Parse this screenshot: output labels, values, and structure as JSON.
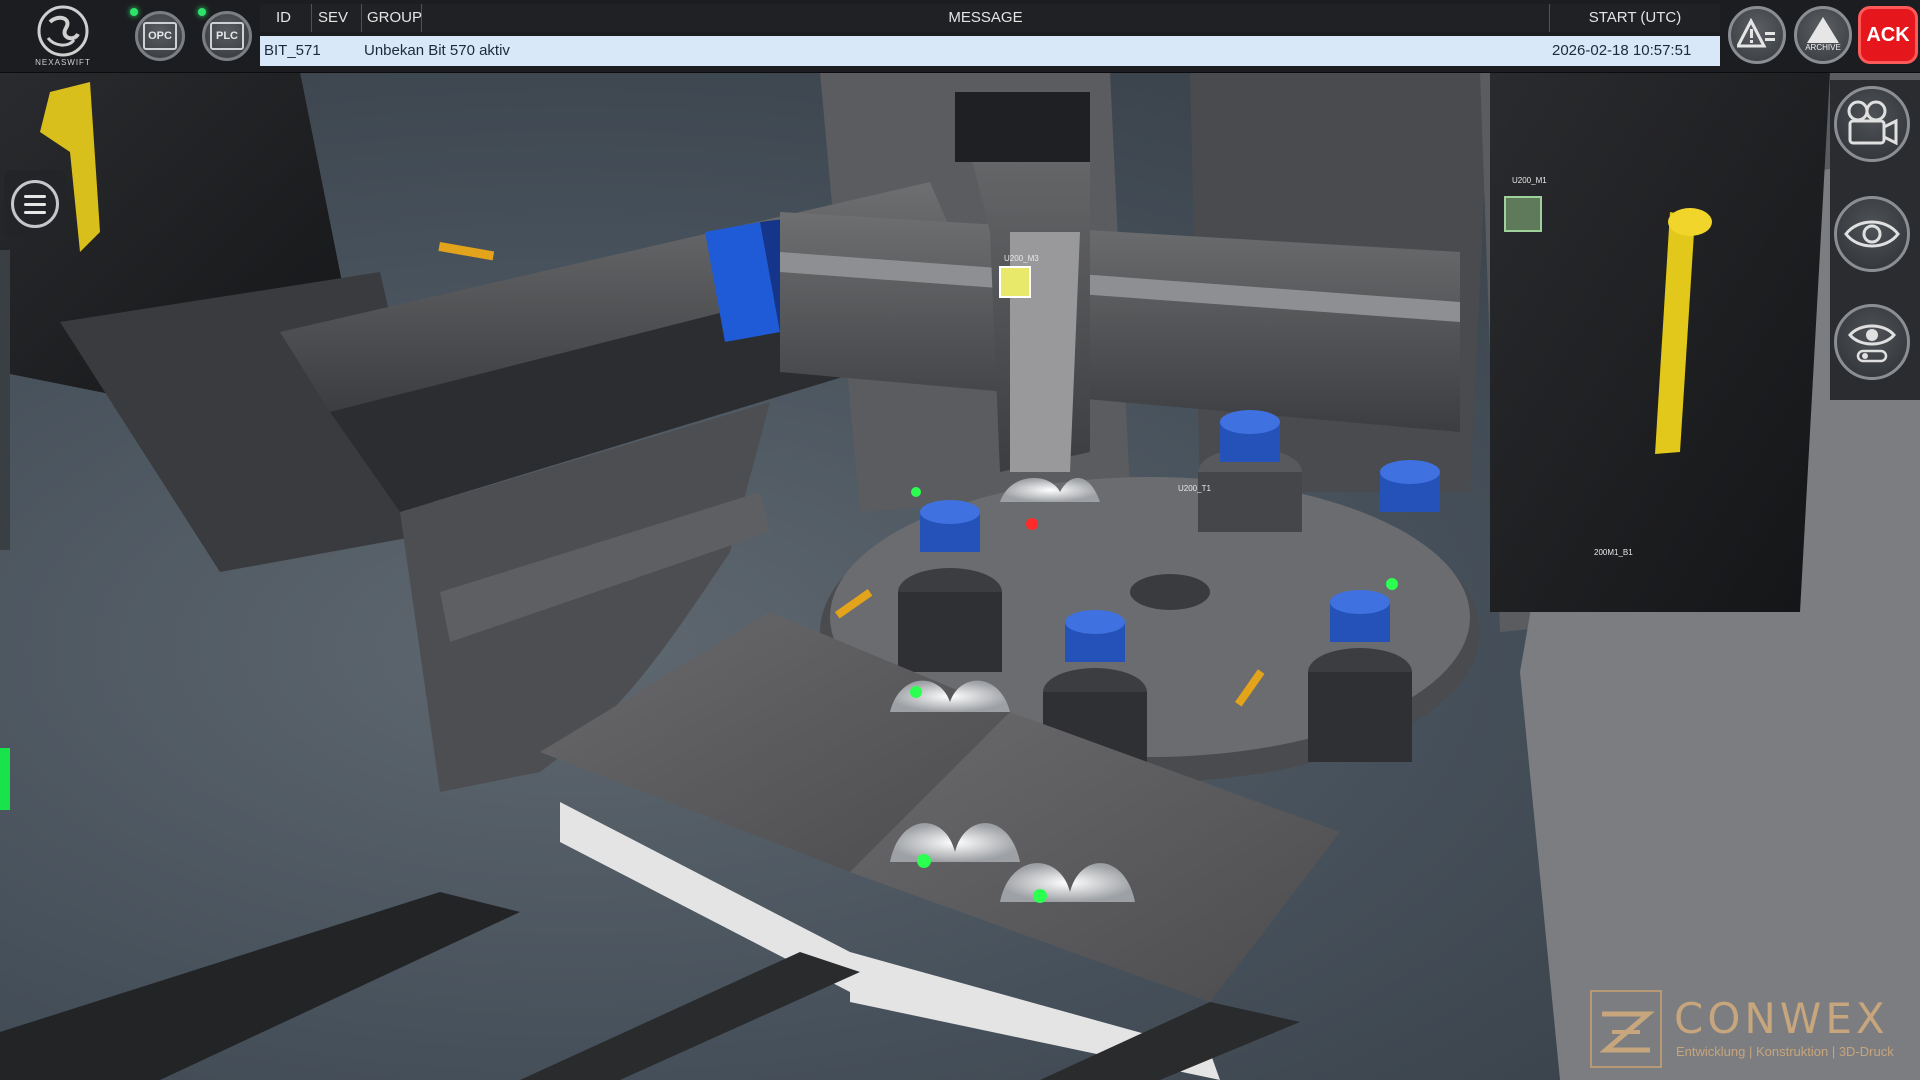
{
  "app": {
    "logo_text": "NEXASWIFT"
  },
  "status_buttons": {
    "opc_label": "OPC",
    "plc_label": "PLC"
  },
  "alarm_table": {
    "headers": {
      "id": "ID",
      "sev": "SEV",
      "group": "GROUP",
      "message": "MESSAGE",
      "start": "START (UTC)"
    },
    "rows": [
      {
        "id": "BIT_571",
        "sev": "",
        "group": "",
        "message": "Unbekan Bit 570 aktiv",
        "start": "2026-02-18 10:57:51"
      }
    ]
  },
  "toolbar": {
    "archive_label": "ARCHIVE",
    "ack_label": "ACK"
  },
  "scene_tags": [
    "U200_M1",
    "U200_M3",
    "U200_T1",
    "200M1_B1"
  ],
  "watermark": {
    "name": "CONWEX",
    "tagline": "Entwicklung | Konstruktion | 3D-Druck"
  },
  "colors": {
    "ack_red": "#e6171c",
    "selected_row": "#d8e8f9",
    "status_green": "#2ee36a",
    "brand_gold": "#c7a57d"
  }
}
